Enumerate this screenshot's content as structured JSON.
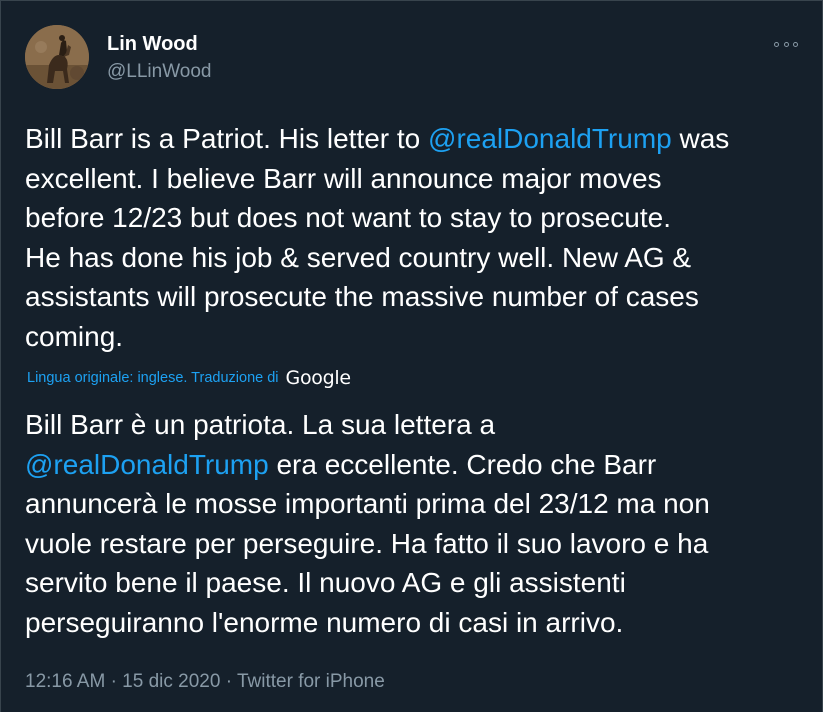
{
  "author": {
    "name": "Lin Wood",
    "handle": "@LLinWood"
  },
  "tweet": {
    "original_lines": [
      {
        "before": "Bill Barr is a Patriot. His letter to ",
        "mention": "@realDonaldTrump",
        "after": " was"
      },
      {
        "before": "excellent. I believe Barr will announce major moves",
        "mention": "",
        "after": ""
      },
      {
        "before": "before 12/23 but does not want to stay to prosecute.",
        "mention": "",
        "after": ""
      },
      {
        "before": "He has done his job & served country well. New AG &",
        "mention": "",
        "after": ""
      },
      {
        "before": "assistants will prosecute the massive number of cases",
        "mention": "",
        "after": ""
      },
      {
        "before": "coming.",
        "mention": "",
        "after": ""
      }
    ],
    "translation_note": "Lingua originale: inglese. Traduzione di",
    "translation_provider": "Google",
    "translated_lines": [
      {
        "before": "Bill Barr è un patriota. La sua lettera a",
        "mention": "",
        "after": ""
      },
      {
        "before": "",
        "mention": "@realDonaldTrump",
        "after": " era eccellente. Credo che Barr"
      },
      {
        "before": "annuncerà le mosse importanti prima del 23/12 ma non",
        "mention": "",
        "after": ""
      },
      {
        "before": "vuole restare per perseguire. Ha fatto il suo lavoro e ha",
        "mention": "",
        "after": ""
      },
      {
        "before": "servito bene il paese. Il nuovo AG e gli assistenti",
        "mention": "",
        "after": ""
      },
      {
        "before": "perseguiranno l'enorme numero di casi in arrivo.",
        "mention": "",
        "after": ""
      }
    ],
    "time": "12:16 AM",
    "separator": "·",
    "date": "15 dic 2020",
    "source": "Twitter for iPhone"
  },
  "icons": {
    "more": "more-options-icon"
  },
  "colors": {
    "background": "#15202b",
    "text": "#ffffff",
    "secondary": "#8899a6",
    "link": "#1da1f2",
    "border": "#38444d"
  }
}
